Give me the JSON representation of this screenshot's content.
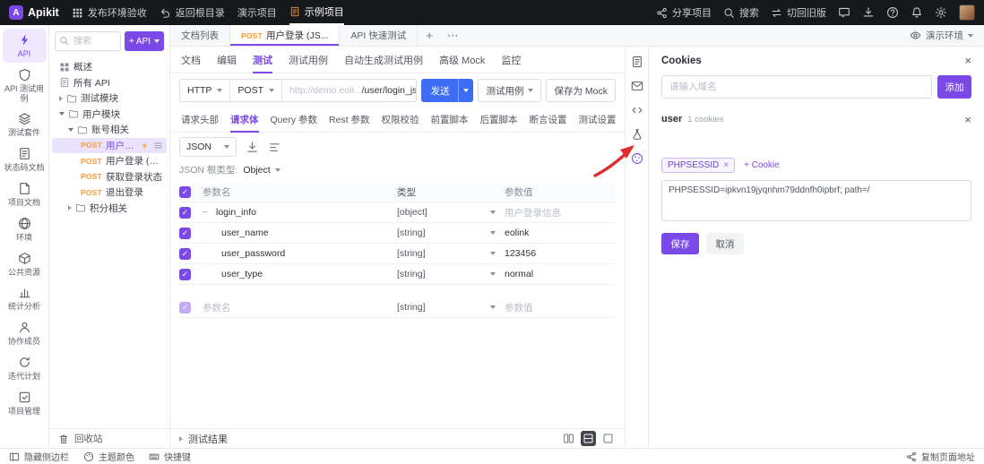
{
  "colors": {
    "accent": "#7a49e8",
    "send_blue": "#3d6df2",
    "post_orange": "#ff9a2e",
    "arrow_red": "#e02b2b"
  },
  "topbar": {
    "logo_letter": "A",
    "app_name": "Apikit",
    "env_check": "发布环境验收",
    "back_root": "返回根目录",
    "demo_project": "演示项目",
    "example_project": "示例项目",
    "share": "分享项目",
    "search": "搜索",
    "switch_old": "切回旧版"
  },
  "sidebar": {
    "items": [
      {
        "label": "API"
      },
      {
        "label": "API 测试用例"
      },
      {
        "label": "测试套件"
      },
      {
        "label": "状态码文档"
      },
      {
        "label": "项目文档"
      },
      {
        "label": "环境"
      },
      {
        "label": "公共资源"
      },
      {
        "label": "统计分析"
      },
      {
        "label": "协作成员"
      },
      {
        "label": "迭代计划"
      },
      {
        "label": "项目管理"
      }
    ]
  },
  "tree": {
    "search_placeholder": "搜索",
    "add_button": "+ API",
    "nodes": [
      {
        "label": "概述"
      },
      {
        "label": "所有 API"
      },
      {
        "label": "测试模块"
      },
      {
        "label": "用户模块"
      },
      {
        "label": "账号相关"
      },
      {
        "method": "POST",
        "label": "用户登录..."
      },
      {
        "method": "POST",
        "label": "用户登录 (表单参..."
      },
      {
        "method": "POST",
        "label": "获取登录状态"
      },
      {
        "method": "POST",
        "label": "退出登录"
      },
      {
        "label": "积分相关"
      }
    ],
    "recycle_bin": "回收站"
  },
  "tabs": {
    "doc_list": "文档列表",
    "active": {
      "method": "POST",
      "label": "用户登录 (JS..."
    },
    "quick_test": "API 快速测试",
    "env_selector": "演示环境"
  },
  "subtabs": {
    "items": [
      "文档",
      "编辑",
      "测试",
      "测试用例",
      "自动生成测试用例",
      "高级 Mock",
      "监控"
    ]
  },
  "request": {
    "protocol": "HTTP",
    "method": "POST",
    "url_prefix": "http://demo.eoli...",
    "url_path": "/user/login_json.php",
    "send": "发送",
    "test_case": "测试用例",
    "save_mock": "保存为 Mock"
  },
  "body_tabs": {
    "items": [
      "请求头部",
      "请求体",
      "Query 参数",
      "Rest 参数",
      "权限校验",
      "前置脚本",
      "后置脚本",
      "断言设置",
      "测试设置"
    ]
  },
  "editor": {
    "format": "JSON",
    "root_label": "JSON 根类型:",
    "root_type": "Object"
  },
  "table": {
    "headers": [
      "参数名",
      "类型",
      "参数值"
    ],
    "rows": [
      {
        "name": "login_info",
        "type": "[object]",
        "value": "用户登录信息"
      },
      {
        "name": "user_name",
        "type": "[string]",
        "value": "eolink"
      },
      {
        "name": "user_password",
        "type": "[string]",
        "value": "123456"
      },
      {
        "name": "user_type",
        "type": "[string]",
        "value": "normal"
      },
      {
        "name": "参数名",
        "type": "[string]",
        "value": "参数值"
      }
    ]
  },
  "results": {
    "label": "测试结果"
  },
  "cookies": {
    "title": "Cookies",
    "domain_placeholder": "请输入域名",
    "add_button": "添加",
    "group_name": "user",
    "group_count": "1 cookies",
    "cookie_name": "PHPSESSID",
    "add_cookie": "+ Cookie",
    "cookie_value": "PHPSESSID=ipkvn19jyqnhm79ddnfh0ipbrf; path=/",
    "save": "保存",
    "cancel": "取消"
  },
  "statusbar": {
    "hide_sidebar": "隐藏侧边栏",
    "theme_color": "主题颜色",
    "shortcuts": "快捷键",
    "copy_url": "复制页面地址"
  }
}
